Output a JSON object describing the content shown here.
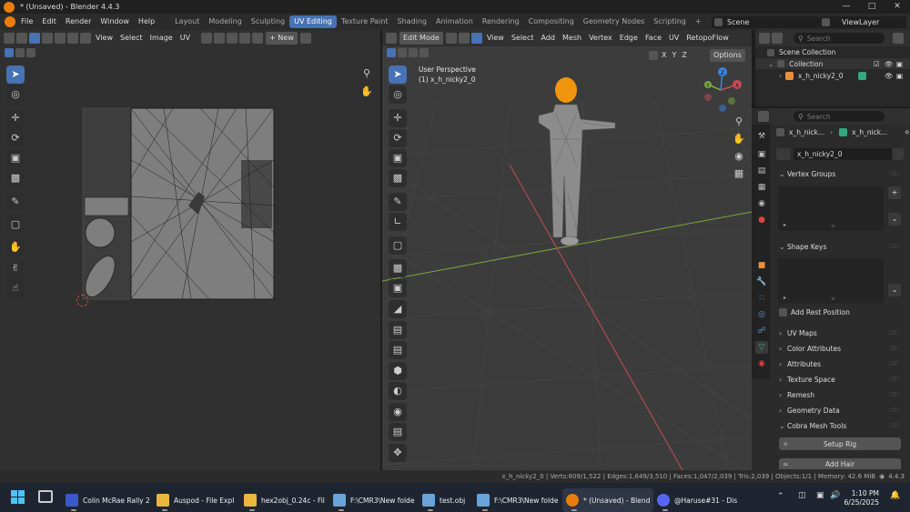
{
  "window": {
    "title": "* (Unsaved) - Blender 4.4.3"
  },
  "menu": [
    "File",
    "Edit",
    "Render",
    "Window",
    "Help"
  ],
  "workspaces": [
    "Layout",
    "Modeling",
    "Sculpting",
    "UV Editing",
    "Texture Paint",
    "Shading",
    "Animation",
    "Rendering",
    "Compositing",
    "Geometry Nodes",
    "Scripting",
    "+"
  ],
  "active_workspace_index": 3,
  "scene": {
    "name": "Scene",
    "view_layer": "ViewLayer"
  },
  "uv_editor": {
    "menus": [
      "View",
      "Select",
      "Image",
      "UV"
    ],
    "new_button": "+ New"
  },
  "viewport": {
    "mode": "Edit Mode",
    "menus": [
      "View",
      "Select",
      "Add",
      "Mesh",
      "Vertex",
      "Edge",
      "Face",
      "UV",
      "RetopoFlow"
    ],
    "options": "Options",
    "axes": [
      "X",
      "Y",
      "Z"
    ],
    "info_line1": "User Perspective",
    "info_line2": "(1) x_h_nicky2_0",
    "gizmo": [
      "Z",
      "Y",
      "X"
    ]
  },
  "outliner": {
    "search_placeholder": "Search",
    "scene_collection": "Scene Collection",
    "collection": "Collection",
    "object": "x_h_nicky2_0"
  },
  "properties": {
    "search_placeholder": "Search",
    "breadcrumb_object": "x_h_nick...",
    "breadcrumb_mesh": "x_h_nick...",
    "mesh_name": "x_h_nicky2_0",
    "panels": {
      "vertex_groups": "Vertex Groups",
      "shape_keys": "Shape Keys",
      "add_rest_position": "Add Rest Position",
      "uv_maps": "UV Maps",
      "color_attributes": "Color Attributes",
      "attributes": "Attributes",
      "texture_space": "Texture Space",
      "remesh": "Remesh",
      "geometry_data": "Geometry Data",
      "cobra_mesh_tools": "Cobra Mesh Tools"
    },
    "setup_rig": "Setup Rig",
    "add_hair": "Add Hair"
  },
  "statusbar": {
    "text": "x_h_nicky2_0 | Verts:609/1,522 | Edges:1,649/3,510 | Faces:1,047/2,039 | Tris:2,039 | Objects:1/1 | Memory: 42.6 MiB",
    "version": "4.4.3"
  },
  "taskbar": {
    "apps": [
      "Colin McRae Rally 2",
      "Auspod - File Expl",
      "hex2obj_0.24c - Fil",
      "F:\\CMR3\\New folde",
      "test.obj",
      "F:\\CMR3\\New folde",
      "* (Unsaved) - Blend",
      "@Haruse#31 - Dis"
    ],
    "time": "1:10 PM",
    "date": "6/25/2025"
  },
  "colors": {
    "accent": "#4772b3",
    "blender_orange": "#e87d0d",
    "x_axis": "#c44d56",
    "y_axis": "#7aa83d",
    "z_axis": "#3b83e0"
  }
}
